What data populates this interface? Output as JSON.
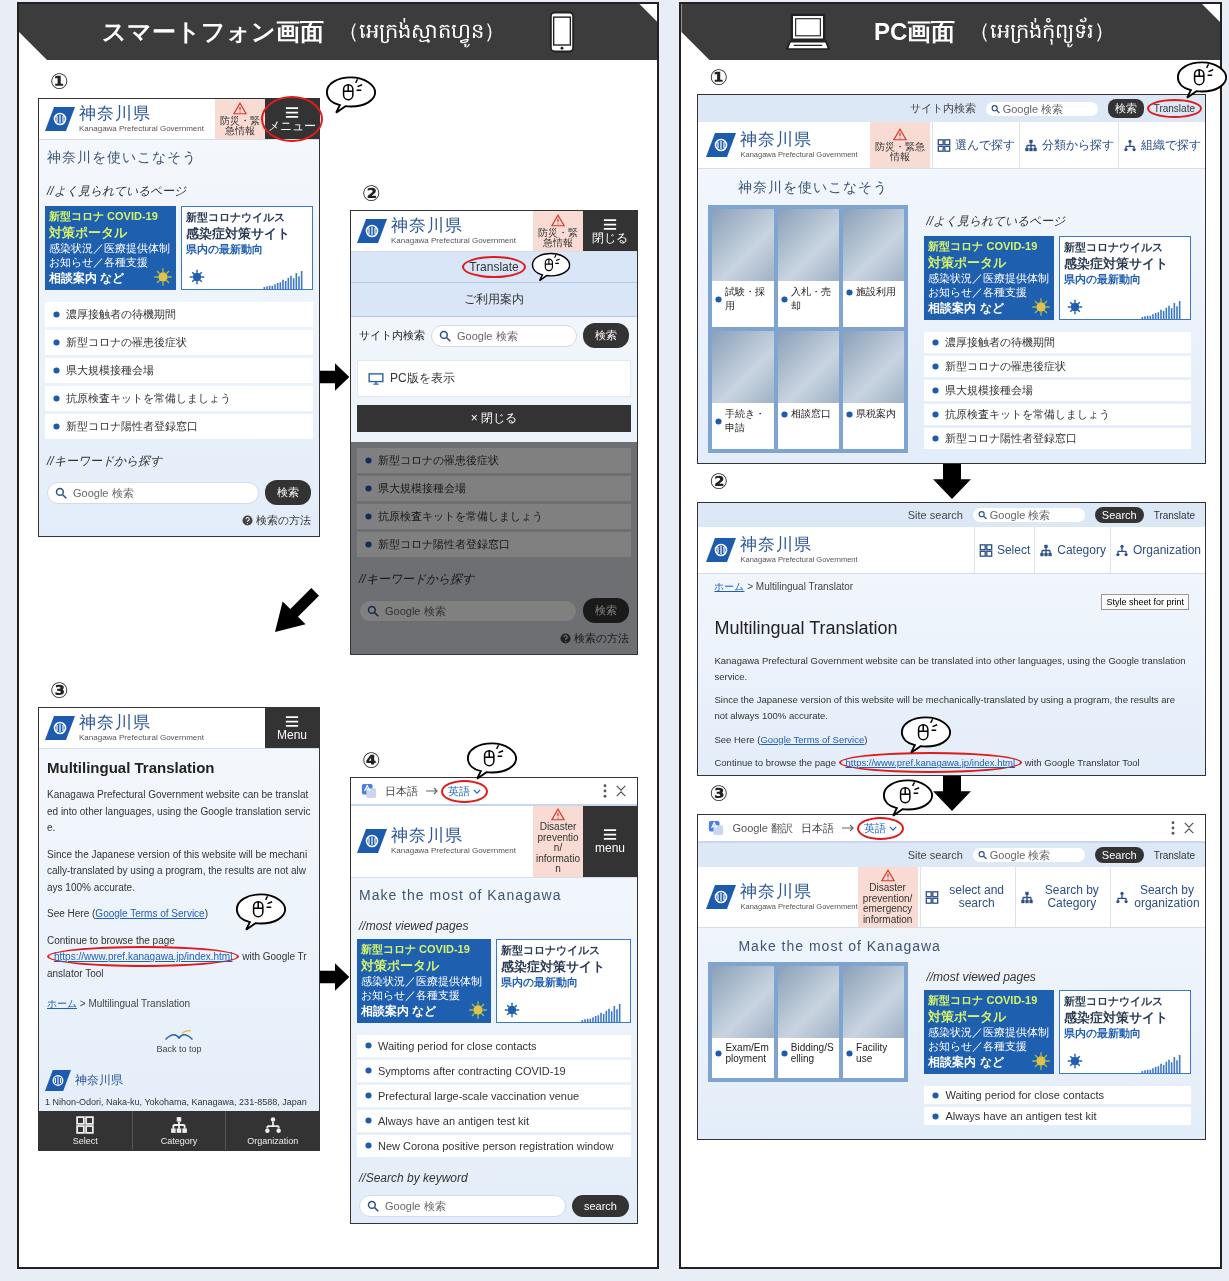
{
  "panels": [
    {
      "kind": "phone",
      "title": "スマートフォン画面",
      "subtitle": "（អេក្រង់ស្មាតហ្វូន）",
      "steps": [
        {
          "number": "①",
          "screen": {
            "sections": [
              {
                "dimmed": false,
                "columns": [
                  {
                    "blocks": [
                      {
                        "kind": "header",
                        "logo": "神奈川県",
                        "logo_sub": "Kanagawa Prefectural Government",
                        "buttons": [
                          {
                            "kind": "alert",
                            "text": "防災・緊急情報",
                            "highlighted": false
                          },
                          {
                            "kind": "menu",
                            "text": "メニュー",
                            "highlighted": true
                          }
                        ]
                      },
                      {
                        "kind": "heading",
                        "text": "神奈川を使いこなそう"
                      },
                      {
                        "kind": "section",
                        "text": "//よく見られているページ"
                      },
                      {
                        "kind": "banners",
                        "items": [
                          {
                            "kind": "dark",
                            "lines": [
                              "新型コロナ COVID-19",
                              "対策ポータル",
                              "感染状況／医療提供体制",
                              "お知らせ／各種支援",
                              "相談案内 など"
                            ]
                          },
                          {
                            "kind": "light",
                            "lines": [
                              "新型コロナウイルス",
                              "感染症対策サイト",
                              "県内の最新動向"
                            ]
                          }
                        ]
                      },
                      {
                        "kind": "links",
                        "items": [
                          "濃厚接触者の待機期間",
                          "新型コロナの罹患後症状",
                          "県大規模接種会場",
                          "抗原検査キットを常備しましょう",
                          "新型コロナ陽性者登録窓口"
                        ]
                      },
                      {
                        "kind": "section",
                        "text": "//キーワードから探す"
                      },
                      {
                        "kind": "search",
                        "placeholder": "Google 検索",
                        "button": "検索"
                      },
                      {
                        "kind": "help",
                        "text": "検索の方法"
                      }
                    ]
                  }
                ]
              }
            ]
          }
        },
        {
          "number": "②",
          "screen": {
            "sections": [
              {
                "dimmed": false,
                "columns": [
                  {
                    "blocks": [
                      {
                        "kind": "header",
                        "logo": "神奈川県",
                        "logo_sub": "Kanagawa Prefectural Government",
                        "buttons": [
                          {
                            "kind": "alert",
                            "text": "防災・緊急情報",
                            "highlighted": false
                          },
                          {
                            "kind": "menu",
                            "text": "閉じる",
                            "highlighted": false
                          }
                        ]
                      },
                      {
                        "kind": "menu",
                        "items": [
                          {
                            "kind": "plain",
                            "text": "Translate",
                            "highlighted": true
                          },
                          {
                            "kind": "plain",
                            "text": "ご利用案内",
                            "highlighted": false
                          }
                        ]
                      },
                      {
                        "kind": "search",
                        "label": "サイト内検索",
                        "placeholder": "Google 検索",
                        "button": "検索"
                      },
                      {
                        "kind": "menu",
                        "items": [
                          {
                            "kind": "pc",
                            "text": "PC版を表示",
                            "highlighted": false
                          }
                        ]
                      },
                      {
                        "kind": "close_button",
                        "text": "× 閉じる"
                      }
                    ]
                  }
                ]
              },
              {
                "dimmed": true,
                "columns": [
                  {
                    "blocks": [
                      {
                        "kind": "links",
                        "items": [
                          "新型コロナの罹患後症状",
                          "県大規模接種会場",
                          "抗原検査キットを常備しましょう",
                          "新型コロナ陽性者登録窓口"
                        ]
                      },
                      {
                        "kind": "section",
                        "text": "//キーワードから探す"
                      },
                      {
                        "kind": "search",
                        "placeholder": "Google 検索",
                        "button": "検索"
                      },
                      {
                        "kind": "help",
                        "text": "検索の方法"
                      }
                    ]
                  }
                ]
              }
            ]
          }
        },
        {
          "number": "③",
          "screen": {
            "sections": [
              {
                "dimmed": false,
                "columns": [
                  {
                    "blocks": [
                      {
                        "kind": "header",
                        "logo": "神奈川県",
                        "logo_sub": "Kanagawa Prefectural Government",
                        "buttons": [
                          {
                            "kind": "menu",
                            "text": "Menu",
                            "highlighted": false
                          }
                        ]
                      },
                      {
                        "kind": "title",
                        "text": "Multilingual Translation"
                      },
                      {
                        "kind": "paragraph",
                        "parts": [
                          {
                            "kind": "plain",
                            "text": "Kanagawa Prefectural Government website can be translated into other languages, using the Google translation service."
                          }
                        ]
                      },
                      {
                        "kind": "paragraph",
                        "parts": [
                          {
                            "kind": "plain",
                            "text": "Since the Japanese version of this website will be mechanically-translated by using a program, the results are not always 100% accurate."
                          }
                        ]
                      },
                      {
                        "kind": "paragraph",
                        "parts": [
                          {
                            "kind": "plain",
                            "text": "See Here ("
                          },
                          {
                            "kind": "link",
                            "text": "Google Terms of Service",
                            "highlighted": false
                          },
                          {
                            "kind": "plain",
                            "text": ")"
                          }
                        ]
                      },
                      {
                        "kind": "paragraph",
                        "parts": [
                          {
                            "kind": "plain",
                            "text": "Continue to browse the page "
                          },
                          {
                            "kind": "link",
                            "text": "https://www.pref.kanagawa.jp/index.html",
                            "highlighted": true
                          },
                          {
                            "kind": "plain",
                            "text": " with Google Translator Tool"
                          }
                        ]
                      },
                      {
                        "kind": "breadcrumb",
                        "parts": [
                          {
                            "kind": "link",
                            "text": "ホーム",
                            "highlighted": false
                          },
                          {
                            "kind": "plain",
                            "text": " > Multilingual Translation"
                          }
                        ]
                      },
                      {
                        "kind": "back_to_top",
                        "text": "Back to top"
                      },
                      {
                        "kind": "footer",
                        "logo": "神奈川県",
                        "address": "1 Nihon-Odori, Naka-ku, Yokohama, Kanagawa, 231-8588, Japan"
                      },
                      {
                        "kind": "bottom_nav",
                        "items": [
                          {
                            "kind": "select",
                            "text": "Select"
                          },
                          {
                            "kind": "category",
                            "text": "Category"
                          },
                          {
                            "kind": "organization",
                            "text": "Organization"
                          }
                        ]
                      }
                    ]
                  }
                ]
              }
            ]
          }
        },
        {
          "number": "④",
          "screen": {
            "sections": [
              {
                "dimmed": false,
                "columns": [
                  {
                    "blocks": [
                      {
                        "kind": "translate_bar",
                        "source": "日本語",
                        "target": "英語",
                        "highlighted": true
                      },
                      {
                        "kind": "header",
                        "logo": "神奈川県",
                        "logo_sub": "Kanagawa Prefectural Government",
                        "buttons": [
                          {
                            "kind": "alert",
                            "text": "Disaster prevention/ information",
                            "highlighted": false
                          },
                          {
                            "kind": "menu",
                            "text": "menu",
                            "highlighted": false
                          }
                        ]
                      },
                      {
                        "kind": "heading",
                        "text": "Make the most of Kanagawa"
                      },
                      {
                        "kind": "section",
                        "text": "//most viewed pages"
                      },
                      {
                        "kind": "banners",
                        "items": [
                          {
                            "kind": "dark",
                            "lines": [
                              "新型コロナ COVID-19",
                              "対策ポータル",
                              "感染状況／医療提供体制",
                              "お知らせ／各種支援",
                              "相談案内 など"
                            ]
                          },
                          {
                            "kind": "light",
                            "lines": [
                              "新型コロナウイルス",
                              "感染症対策サイト",
                              "県内の最新動向"
                            ]
                          }
                        ]
                      },
                      {
                        "kind": "links",
                        "items": [
                          "Waiting period for close contacts",
                          "Symptoms after contracting COVID-19",
                          "Prefectural large-scale vaccination venue",
                          "Always have an antigen test kit",
                          "New Corona positive person registration window"
                        ]
                      },
                      {
                        "kind": "section",
                        "text": "//Search by keyword"
                      },
                      {
                        "kind": "search",
                        "placeholder": "Google 検索",
                        "button": "search"
                      }
                    ]
                  }
                ]
              }
            ]
          }
        }
      ]
    },
    {
      "kind": "pc",
      "title": "PC画面",
      "subtitle": "（អេក្រង់កុំព្យូទ័រ）",
      "steps": [
        {
          "number": "①",
          "screen": {
            "sections": [
              {
                "dimmed": false,
                "columns": [
                  {
                    "blocks": [
                      {
                        "kind": "topbar",
                        "items": [
                          {
                            "kind": "label",
                            "text": "サイト内検索",
                            "highlighted": false
                          },
                          {
                            "kind": "search",
                            "placeholder": "Google 検索",
                            "highlighted": false
                          },
                          {
                            "kind": "button",
                            "text": "検索",
                            "highlighted": false
                          },
                          {
                            "kind": "link",
                            "text": "Translate",
                            "highlighted": true
                          }
                        ]
                      },
                      {
                        "kind": "header",
                        "logo": "神奈川県",
                        "logo_sub": "Kanagawa Prefectural Government",
                        "buttons": [
                          {
                            "kind": "alert",
                            "text": "防災・緊急情報",
                            "highlighted": false
                          },
                          {
                            "kind": "select",
                            "text": "選んで探す",
                            "highlighted": false
                          },
                          {
                            "kind": "category",
                            "text": "分類から探す",
                            "highlighted": false
                          },
                          {
                            "kind": "organization",
                            "text": "組織で探す",
                            "highlighted": false
                          }
                        ]
                      },
                      {
                        "kind": "heading",
                        "text": "神奈川を使いこなそう"
                      }
                    ]
                  }
                ]
              },
              {
                "dimmed": false,
                "columns": [
                  {
                    "blocks": [
                      {
                        "kind": "photos",
                        "captions": [
                          "試験・採用",
                          "入札・売却",
                          "施設利用",
                          "手続き・申請",
                          "相談窓口",
                          "県税案内"
                        ]
                      }
                    ]
                  },
                  {
                    "blocks": [
                      {
                        "kind": "section",
                        "text": "//よく見られているページ"
                      },
                      {
                        "kind": "banners",
                        "items": [
                          {
                            "kind": "dark",
                            "lines": [
                              "新型コロナ COVID-19",
                              "対策ポータル",
                              "感染状況／医療提供体制",
                              "お知らせ／各種支援",
                              "相談案内 など"
                            ]
                          },
                          {
                            "kind": "light",
                            "lines": [
                              "新型コロナウイルス",
                              "感染症対策サイト",
                              "県内の最新動向"
                            ]
                          }
                        ]
                      },
                      {
                        "kind": "links",
                        "items": [
                          "濃厚接触者の待機期間",
                          "新型コロナの罹患後症状",
                          "県大規模接種会場",
                          "抗原検査キットを常備しましょう",
                          "新型コロナ陽性者登録窓口"
                        ]
                      }
                    ]
                  }
                ]
              }
            ]
          }
        },
        {
          "number": "②",
          "screen": {
            "sections": [
              {
                "dimmed": false,
                "columns": [
                  {
                    "blocks": [
                      {
                        "kind": "topbar",
                        "items": [
                          {
                            "kind": "label",
                            "text": "Site search",
                            "highlighted": false
                          },
                          {
                            "kind": "search",
                            "placeholder": "Google 検索",
                            "highlighted": false
                          },
                          {
                            "kind": "button",
                            "text": "Search",
                            "highlighted": false
                          },
                          {
                            "kind": "link",
                            "text": "Translate",
                            "highlighted": false
                          }
                        ]
                      },
                      {
                        "kind": "header",
                        "logo": "神奈川県",
                        "logo_sub": "Kanagawa Prefectural Government",
                        "buttons": [
                          {
                            "kind": "select",
                            "text": "Select",
                            "highlighted": false
                          },
                          {
                            "kind": "category",
                            "text": "Category",
                            "highlighted": false
                          },
                          {
                            "kind": "organization",
                            "text": "Organization",
                            "highlighted": false
                          }
                        ]
                      },
                      {
                        "kind": "breadcrumb",
                        "parts": [
                          {
                            "kind": "link",
                            "text": "ホーム",
                            "highlighted": false
                          },
                          {
                            "kind": "plain",
                            "text": " > Multilingual Translator"
                          }
                        ]
                      },
                      {
                        "kind": "print_button",
                        "text": "Style sheet for print"
                      },
                      {
                        "kind": "title",
                        "text": "Multilingual Translation"
                      },
                      {
                        "kind": "paragraph",
                        "parts": [
                          {
                            "kind": "plain",
                            "text": "Kanagawa Prefectural Government website can be translated into other languages, using the Google translation service."
                          }
                        ]
                      },
                      {
                        "kind": "paragraph",
                        "parts": [
                          {
                            "kind": "plain",
                            "text": "Since the Japanese version of this website will be mechanically-translated by using a program, the results are not always 100% accurate."
                          }
                        ]
                      },
                      {
                        "kind": "paragraph",
                        "parts": [
                          {
                            "kind": "plain",
                            "text": "See Here ("
                          },
                          {
                            "kind": "link",
                            "text": "Google Terms of Service",
                            "highlighted": false
                          },
                          {
                            "kind": "plain",
                            "text": ")"
                          }
                        ]
                      },
                      {
                        "kind": "paragraph",
                        "parts": [
                          {
                            "kind": "plain",
                            "text": "Continue to browse the page "
                          },
                          {
                            "kind": "link",
                            "text": "https://www.pref.kanagawa.jp/index.html",
                            "highlighted": true
                          },
                          {
                            "kind": "plain",
                            "text": " with Google Translator Tool"
                          }
                        ]
                      }
                    ]
                  }
                ]
              }
            ]
          }
        },
        {
          "number": "③",
          "screen": {
            "sections": [
              {
                "dimmed": false,
                "columns": [
                  {
                    "blocks": [
                      {
                        "kind": "translate_bar",
                        "brand": "Google 翻訳",
                        "source": "日本語",
                        "target": "英語",
                        "highlighted": true
                      },
                      {
                        "kind": "topbar",
                        "items": [
                          {
                            "kind": "label",
                            "text": "Site search",
                            "highlighted": false
                          },
                          {
                            "kind": "search",
                            "placeholder": "Google 検索",
                            "highlighted": false
                          },
                          {
                            "kind": "button",
                            "text": "Search",
                            "highlighted": false
                          },
                          {
                            "kind": "link",
                            "text": "Translate",
                            "highlighted": false
                          }
                        ]
                      },
                      {
                        "kind": "header",
                        "logo": "神奈川県",
                        "logo_sub": "Kanagawa Prefectural Government",
                        "buttons": [
                          {
                            "kind": "alert",
                            "text": "Disaster prevention/emergency information",
                            "highlighted": false
                          },
                          {
                            "kind": "select",
                            "text": "select and search",
                            "highlighted": false
                          },
                          {
                            "kind": "category",
                            "text": "Search by Category",
                            "highlighted": false
                          },
                          {
                            "kind": "organization",
                            "text": "Search by organization",
                            "highlighted": false
                          }
                        ]
                      },
                      {
                        "kind": "heading",
                        "text": "Make the most of Kanagawa"
                      }
                    ]
                  }
                ]
              },
              {
                "dimmed": false,
                "columns": [
                  {
                    "blocks": [
                      {
                        "kind": "photos",
                        "captions": [
                          "Exam/Employment",
                          "Bidding/Selling",
                          "Facility use"
                        ]
                      }
                    ]
                  },
                  {
                    "blocks": [
                      {
                        "kind": "section",
                        "text": "//most viewed pages"
                      },
                      {
                        "kind": "banners",
                        "items": [
                          {
                            "kind": "dark",
                            "lines": [
                              "新型コロナ COVID-19",
                              "対策ポータル",
                              "感染状況／医療提供体制",
                              "お知らせ／各種支援",
                              "相談案内 など"
                            ]
                          },
                          {
                            "kind": "light",
                            "lines": [
                              "新型コロナウイルス",
                              "感染症対策サイト",
                              "県内の最新動向"
                            ]
                          }
                        ]
                      },
                      {
                        "kind": "links",
                        "items": [
                          "Waiting period for close contacts",
                          "Always have an antigen test kit"
                        ]
                      }
                    ]
                  }
                ]
              }
            ]
          }
        }
      ]
    }
  ]
}
